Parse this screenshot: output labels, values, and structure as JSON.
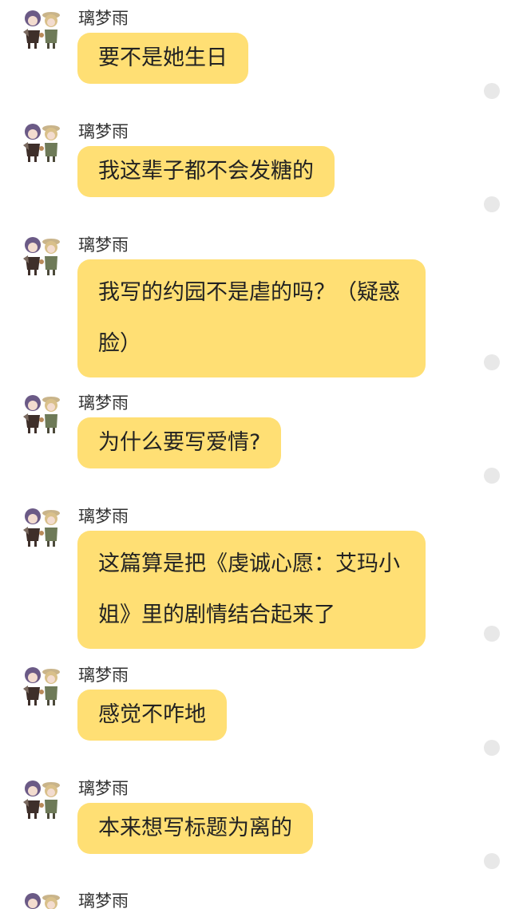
{
  "messages": [
    {
      "sender": "璃梦雨",
      "text": "要不是她生日"
    },
    {
      "sender": "璃梦雨",
      "text": "我这辈子都不会发糖的"
    },
    {
      "sender": "璃梦雨",
      "text": "我写的约园不是虐的吗？（疑惑脸）"
    },
    {
      "sender": "璃梦雨",
      "text": "为什么要写爱情?"
    },
    {
      "sender": "璃梦雨",
      "text": "这篇算是把《虔诚心愿：艾玛小姐》里的剧情结合起来了"
    },
    {
      "sender": "璃梦雨",
      "text": "感觉不咋地"
    },
    {
      "sender": "璃梦雨",
      "text": "本来想写标题为离的"
    },
    {
      "sender": "璃梦雨",
      "text": ""
    }
  ],
  "colors": {
    "bubble": "#ffdf74",
    "read_dot": "#e8e8e8",
    "background": "#ffffff"
  },
  "icons": {
    "avatar": "anime-characters-avatar-icon",
    "status": "read-status-dot-icon"
  }
}
